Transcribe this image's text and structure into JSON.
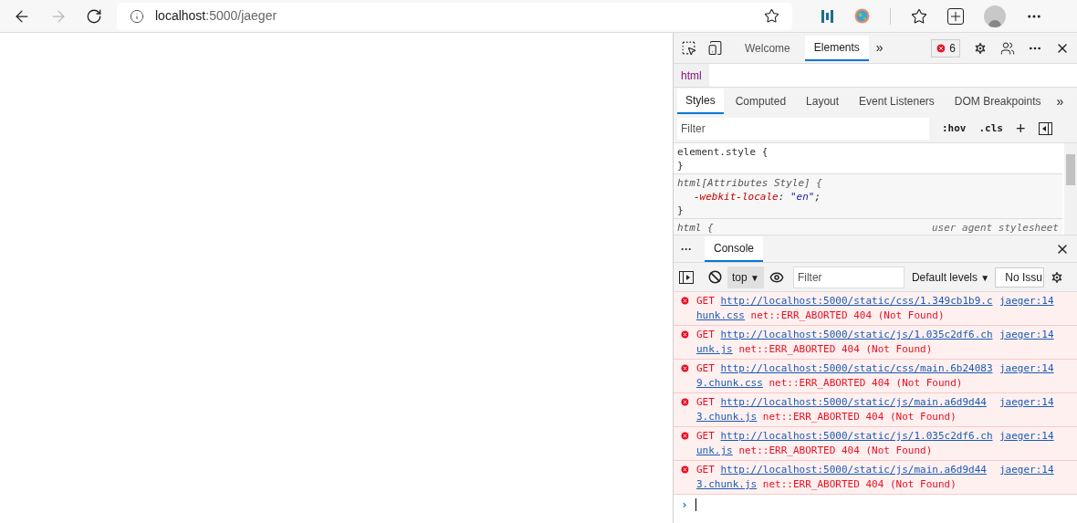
{
  "browser": {
    "url_host": "localhost",
    "url_rest": ":5000/jaeger"
  },
  "devtools": {
    "tabs": [
      {
        "label": "Welcome",
        "selected": false
      },
      {
        "label": "Elements",
        "selected": true
      }
    ],
    "more_tabs": "»",
    "error_count": "6",
    "breadcrumb": "html",
    "style_tabs": [
      {
        "label": "Styles",
        "selected": true
      },
      {
        "label": "Computed",
        "selected": false
      },
      {
        "label": "Layout",
        "selected": false
      },
      {
        "label": "Event Listeners",
        "selected": false
      },
      {
        "label": "DOM Breakpoints",
        "selected": false
      }
    ],
    "style_more": "»",
    "filter_placeholder": "Filter",
    "hov": ":hov",
    "cls": ".cls",
    "plus": "+",
    "rules": [
      {
        "selector": "element.style {",
        "italic": false,
        "close": "}"
      },
      {
        "selector": "html[Attributes Style] {",
        "italic": true,
        "lines": [
          {
            "prop": "-webkit-locale",
            "colon": ":",
            "value": "\"en\"",
            "end": ";"
          }
        ],
        "close": "}"
      },
      {
        "selector": "html {",
        "italic": true,
        "source": "user agent stylesheet"
      }
    ]
  },
  "drawer": {
    "more": "···",
    "tab": "Console",
    "context": "top",
    "dropdown_arrow": "▼",
    "filter_placeholder": "Filter",
    "levels": "Default levels",
    "levels_arrow": "▼",
    "issues": "No Issu",
    "messages": [
      {
        "method": "GET",
        "url": "http://localhost:5000/static/css/1.349cb1b9.chunk.css",
        "error": "net::ERR_ABORTED 404 (Not Found)",
        "source": "jaeger:14"
      },
      {
        "method": "GET",
        "url": "http://localhost:5000/static/js/1.035c2df6.chunk.js",
        "error": "net::ERR_ABORTED 404 (Not Found)",
        "source": "jaeger:14"
      },
      {
        "method": "GET",
        "url": "http://localhost:5000/static/css/main.6b240839.chunk.css",
        "error": "net::ERR_ABORTED 404 (Not Found)",
        "source": "jaeger:14"
      },
      {
        "method": "GET",
        "url": "http://localhost:5000/static/js/main.a6d9d443.chunk.js",
        "error": "net::ERR_ABORTED 404 (Not Found)",
        "source": "jaeger:14"
      },
      {
        "method": "GET",
        "url": "http://localhost:5000/static/js/1.035c2df6.chunk.js",
        "error": "net::ERR_ABORTED 404 (Not Found)",
        "source": "jaeger:14"
      },
      {
        "method": "GET",
        "url": "http://localhost:5000/static/js/main.a6d9d443.chunk.js",
        "error": "net::ERR_ABORTED 404 (Not Found)",
        "source": "jaeger:14"
      }
    ],
    "prompt": "›"
  }
}
